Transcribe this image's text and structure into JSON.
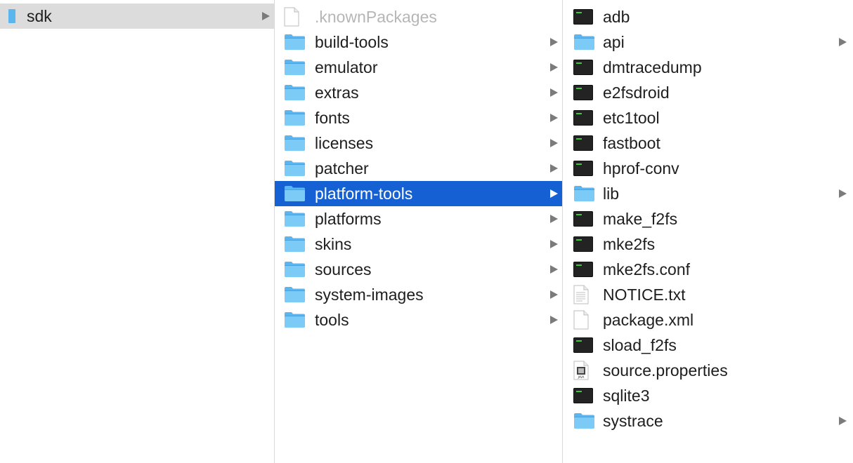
{
  "columns": [
    {
      "items": [
        {
          "label": "sdk",
          "icon": "folder-icon",
          "state": "selected-inactive",
          "has_children": true
        }
      ]
    },
    {
      "items": [
        {
          "label": ".knownPackages",
          "icon": "file-icon",
          "state": "hidden",
          "has_children": false
        },
        {
          "label": "build-tools",
          "icon": "folder-icon",
          "has_children": true
        },
        {
          "label": "emulator",
          "icon": "folder-icon",
          "has_children": true
        },
        {
          "label": "extras",
          "icon": "folder-icon",
          "has_children": true
        },
        {
          "label": "fonts",
          "icon": "folder-icon",
          "has_children": true
        },
        {
          "label": "licenses",
          "icon": "folder-icon",
          "has_children": true
        },
        {
          "label": "patcher",
          "icon": "folder-icon",
          "has_children": true
        },
        {
          "label": "platform-tools",
          "icon": "folder-icon",
          "state": "selected-active",
          "has_children": true
        },
        {
          "label": "platforms",
          "icon": "folder-icon",
          "has_children": true
        },
        {
          "label": "skins",
          "icon": "folder-icon",
          "has_children": true
        },
        {
          "label": "sources",
          "icon": "folder-icon",
          "has_children": true
        },
        {
          "label": "system-images",
          "icon": "folder-icon",
          "has_children": true
        },
        {
          "label": "tools",
          "icon": "folder-icon",
          "has_children": true
        }
      ]
    },
    {
      "items": [
        {
          "label": "adb",
          "icon": "terminal-icon",
          "has_children": false
        },
        {
          "label": "api",
          "icon": "folder-icon",
          "has_children": true
        },
        {
          "label": "dmtracedump",
          "icon": "terminal-icon",
          "has_children": false
        },
        {
          "label": "e2fsdroid",
          "icon": "terminal-icon",
          "has_children": false
        },
        {
          "label": "etc1tool",
          "icon": "terminal-icon",
          "has_children": false
        },
        {
          "label": "fastboot",
          "icon": "terminal-icon",
          "has_children": false
        },
        {
          "label": "hprof-conv",
          "icon": "terminal-icon",
          "has_children": false
        },
        {
          "label": "lib",
          "icon": "folder-icon",
          "has_children": true
        },
        {
          "label": "make_f2fs",
          "icon": "terminal-icon",
          "has_children": false
        },
        {
          "label": "mke2fs",
          "icon": "terminal-icon",
          "has_children": false
        },
        {
          "label": "mke2fs.conf",
          "icon": "terminal-icon",
          "has_children": false
        },
        {
          "label": "NOTICE.txt",
          "icon": "text-file-icon",
          "has_children": false
        },
        {
          "label": "package.xml",
          "icon": "file-icon",
          "has_children": false
        },
        {
          "label": "sload_f2fs",
          "icon": "terminal-icon",
          "has_children": false
        },
        {
          "label": "source.properties",
          "icon": "java-file-icon",
          "has_children": false
        },
        {
          "label": "sqlite3",
          "icon": "terminal-icon",
          "has_children": false
        },
        {
          "label": "systrace",
          "icon": "folder-icon",
          "has_children": true
        }
      ]
    }
  ],
  "colors": {
    "selection_active": "#1560d2",
    "selection_inactive": "#dcdcdc",
    "folder": "#5bb6ef",
    "hidden_text": "#b6b6b6"
  }
}
